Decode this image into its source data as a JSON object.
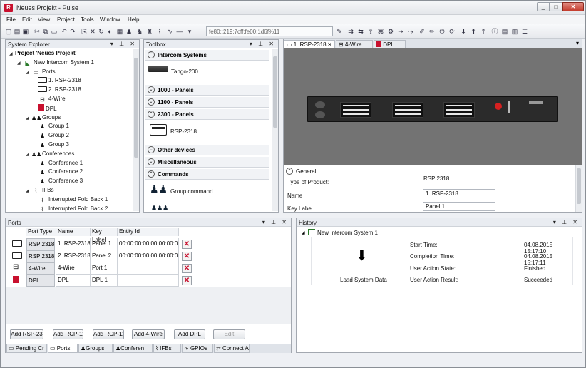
{
  "window": {
    "title": "Neues Projekt - Pulse",
    "app_icon": "R",
    "accent_color": "#c8102e"
  },
  "menu": [
    "File",
    "Edit",
    "View",
    "Project",
    "Tools",
    "Window",
    "Help"
  ],
  "toolbar": {
    "address": "fe80::219:7cff:fe00:1d6f%11"
  },
  "system_explorer": {
    "title": "System Explorer",
    "items": [
      {
        "label": "Project 'Neues Projekt'",
        "level": 0,
        "bold": true,
        "icon": "expand-icon"
      },
      {
        "label": "New Intercom System 1",
        "level": 1,
        "icon": "system-icon"
      },
      {
        "label": "Ports",
        "level": 2,
        "icon": "ports-icon"
      },
      {
        "label": "1. RSP-2318",
        "level": 3,
        "icon": "rsp-icon"
      },
      {
        "label": "2. RSP-2318",
        "level": 3,
        "icon": "rsp-icon"
      },
      {
        "label": "4-Wire",
        "level": 3,
        "icon": "fourwire-icon"
      },
      {
        "label": "DPL",
        "level": 3,
        "icon": "dpl-icon"
      },
      {
        "label": "Groups",
        "level": 2,
        "icon": "groups-icon"
      },
      {
        "label": "Group 1",
        "level": 3,
        "icon": "group-icon"
      },
      {
        "label": "Group 2",
        "level": 3,
        "icon": "group-icon"
      },
      {
        "label": "Group 3",
        "level": 3,
        "icon": "group-icon"
      },
      {
        "label": "Conferences",
        "level": 2,
        "icon": "conferences-icon"
      },
      {
        "label": "Conference 1",
        "level": 3,
        "icon": "conference-icon"
      },
      {
        "label": "Conference 2",
        "level": 3,
        "icon": "conference-icon"
      },
      {
        "label": "Conference 3",
        "level": 3,
        "icon": "conference-icon"
      },
      {
        "label": "IFBs",
        "level": 2,
        "icon": "ifb-icon"
      },
      {
        "label": "Interrupted Fold Back 1",
        "level": 3,
        "icon": "ifb-icon"
      },
      {
        "label": "Interrupted Fold Back 2",
        "level": 3,
        "icon": "ifb-icon"
      }
    ]
  },
  "toolbox": {
    "title": "Toolbox",
    "cat_intercom": "Intercom Systems",
    "item_tango": "Tango-200",
    "cat_1000": "1000 - Panels",
    "cat_1100": "1100 - Panels",
    "cat_2300": "2300 - Panels",
    "item_rsp": "RSP-2318",
    "cat_other": "Other devices",
    "cat_misc": "Miscellaneous",
    "cat_commands": "Commands",
    "item_group_cmd": "Group command"
  },
  "document": {
    "tabs": [
      {
        "label": "1. RSP-2318",
        "active": true
      },
      {
        "label": "4-Wire",
        "active": false
      },
      {
        "label": "DPL",
        "active": false
      }
    ],
    "section": "General",
    "props": {
      "type_label": "Type of Product:",
      "type_value": "RSP 2318",
      "name_label": "Name",
      "name_value": "1. RSP-2318",
      "key_label": "Key Label",
      "key_value": "Panel 1"
    }
  },
  "ports": {
    "title": "Ports",
    "columns": [
      "Port Type",
      "Name",
      "Key Label",
      "Entity Id"
    ],
    "rows": [
      {
        "type": "RSP 2318",
        "name": "1. RSP-2318",
        "key": "Panel 1",
        "entity": "00:00:00:00:00:00:00:00",
        "icon": "rsp-icon"
      },
      {
        "type": "RSP 2318",
        "name": "2. RSP-2318",
        "key": "Panel 2",
        "entity": "00:00:00:00:00:00:00:00",
        "icon": "rsp-icon"
      },
      {
        "type": "4-Wire",
        "name": "4-Wire",
        "key": "Port 1",
        "entity": "",
        "icon": "fourwire-icon"
      },
      {
        "type": "DPL",
        "name": "DPL",
        "key": "DPL 1",
        "entity": "",
        "icon": "dpl-icon"
      }
    ],
    "buttons": [
      "Add RSP-23",
      "Add RCP-11",
      "Add RCP-11",
      "Add 4-Wire",
      "Add DPL",
      "Edit"
    ]
  },
  "bottom_tabs": [
    "Pending Cr",
    "Ports",
    "Groups",
    "Conferen",
    "IFBs",
    "GPIOs",
    "Connect A"
  ],
  "history": {
    "title": "History",
    "system": "New Intercom System 1",
    "action": "Load System Data",
    "start_label": "Start Time:",
    "start_value": "04.08.2015 15:17:10",
    "completion_label": "Completion Time:",
    "completion_value": "04.08.2015 15:17:11",
    "state_label": "User Action State:",
    "state_value": "Finished",
    "result_label": "User Action Result:",
    "result_value": "Succeeded"
  }
}
